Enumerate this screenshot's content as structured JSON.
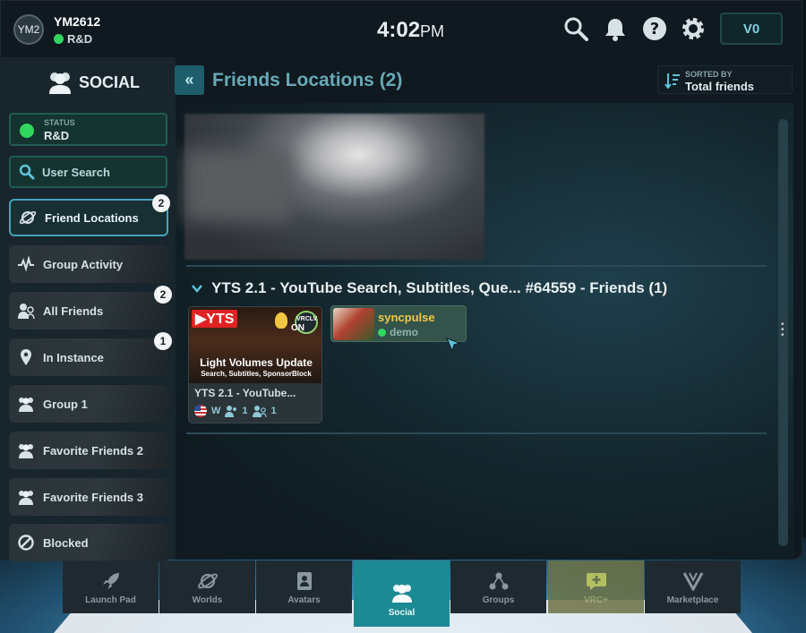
{
  "colors": {
    "accent": "#45a3b8",
    "online": "#31d660",
    "panel": "#18252c"
  },
  "user": {
    "avatar_initials": "YM2",
    "name": "YM2612",
    "status": "R&D"
  },
  "clock": {
    "time": "4:02",
    "ampm": "PM"
  },
  "topbar": {
    "credits": "V0"
  },
  "sidebar": {
    "title": "SOCIAL",
    "status_label": "STATUS",
    "status_value": "R&D",
    "search_label": "User Search",
    "items": [
      {
        "label": "Friend Locations",
        "badge": "2",
        "icon": "planet-icon"
      },
      {
        "label": "Group Activity",
        "badge": "",
        "icon": "activity-icon"
      },
      {
        "label": "All Friends",
        "badge": "2",
        "icon": "friends-icon"
      },
      {
        "label": "In Instance",
        "badge": "1",
        "icon": "pin-icon"
      },
      {
        "label": "Group 1",
        "badge": "",
        "icon": "group-icon"
      },
      {
        "label": "Favorite Friends 2",
        "badge": "",
        "icon": "group-icon"
      },
      {
        "label": "Favorite Friends 3",
        "badge": "",
        "icon": "group-icon"
      },
      {
        "label": "Blocked",
        "badge": "",
        "icon": "blocked-icon"
      }
    ]
  },
  "header": {
    "back_label": "«",
    "title": "Friends Locations (2)",
    "sorted_by_label": "SORTED BY",
    "sorted_by_value": "Total friends"
  },
  "instance": {
    "title": "YTS 2.1 - YouTube Search, Subtitles, Que... #64559 - Friends (1)",
    "world": {
      "name": "YTS 2.1 - YouTube...",
      "thumb_logo": "▶YTS",
      "thumb_badge": "VRCLV",
      "thumb_on": "ON",
      "thumb_line1": "Light Volumes Update",
      "thumb_line2": "Search, Subtitles, SponsorBlock",
      "region": "W",
      "users": "1",
      "friends": "1"
    },
    "friend": {
      "name": "syncpulse",
      "status": "demo"
    }
  },
  "tabs": [
    {
      "label": "Launch Pad",
      "icon": "rocket-icon"
    },
    {
      "label": "Worlds",
      "icon": "planet-icon"
    },
    {
      "label": "Avatars",
      "icon": "avatar-card-icon"
    },
    {
      "label": "Social",
      "icon": "social-icon"
    },
    {
      "label": "Groups",
      "icon": "groups-icon"
    },
    {
      "label": "VRC+",
      "icon": "vrcplus-icon"
    },
    {
      "label": "Marketplace",
      "icon": "marketplace-icon"
    }
  ]
}
